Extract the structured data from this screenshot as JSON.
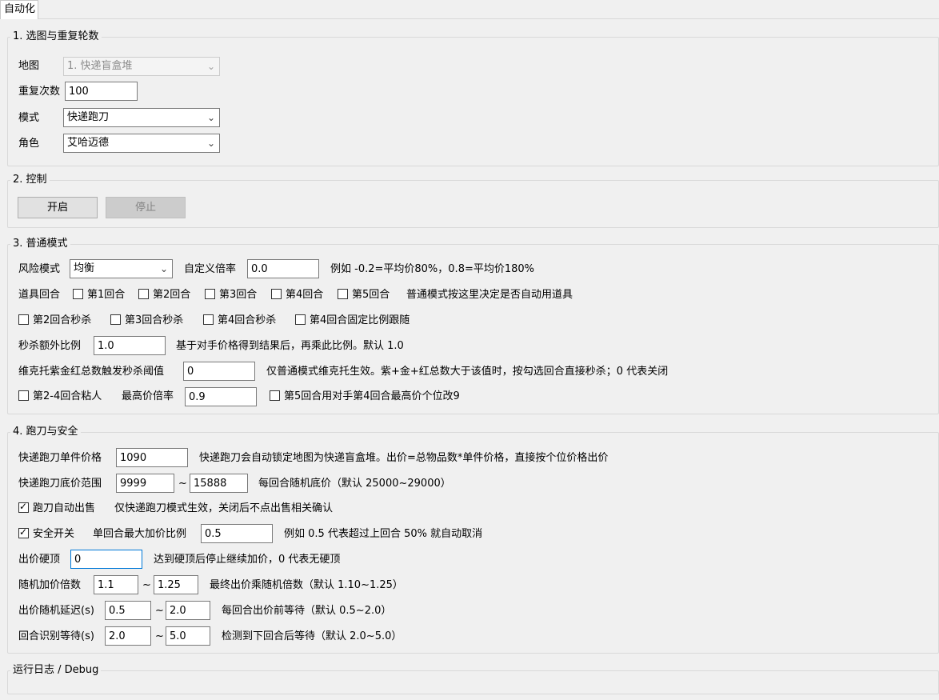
{
  "tab_label": "自动化",
  "sections": {
    "map_repeat": {
      "title": "1. 选图与重复轮数",
      "map_label": "地图",
      "map_value": "1. 快递盲盒堆",
      "repeat_label": "重复次数",
      "repeat_value": "100",
      "mode_label": "模式",
      "mode_value": "快递跑刀",
      "role_label": "角色",
      "role_value": "艾哈迈德"
    },
    "control": {
      "title": "2. 控制",
      "start_label": "开启",
      "stop_label": "停止"
    },
    "normal": {
      "title": "3. 普通模式",
      "risk_label": "风险模式",
      "risk_value": "均衡",
      "custom_rate_label": "自定义倍率",
      "custom_rate_value": "0.0",
      "custom_rate_hint": "例如 -0.2=平均价80%，0.8=平均价180%",
      "item_round_label": "道具回合",
      "rounds": [
        {
          "label": "第1回合",
          "checked": false
        },
        {
          "label": "第2回合",
          "checked": false
        },
        {
          "label": "第3回合",
          "checked": false
        },
        {
          "label": "第4回合",
          "checked": false
        },
        {
          "label": "第5回合",
          "checked": false
        }
      ],
      "item_round_hint": "普通模式按这里决定是否自动用道具",
      "kills": [
        {
          "label": "第2回合秒杀",
          "checked": false
        },
        {
          "label": "第3回合秒杀",
          "checked": false
        },
        {
          "label": "第4回合秒杀",
          "checked": false
        },
        {
          "label": "第4回合固定比例跟随",
          "checked": false
        }
      ],
      "kill_ratio_label": "秒杀额外比例",
      "kill_ratio_value": "1.0",
      "kill_ratio_hint": "基于对手价格得到结果后，再乘此比例。默认 1.0",
      "threshold_label": "维克托紫金红总数触发秒杀阈值",
      "threshold_value": "0",
      "threshold_hint": "仅普通模式维克托生效。紫+金+红总数大于该值时，按勾选回合直接秒杀；0 代表关闭",
      "sticky_label": "第2-4回合粘人",
      "sticky_checked": false,
      "max_rate_label": "最高价倍率",
      "max_rate_value": "0.9",
      "r5_label": "第5回合用对手第4回合最高价个位改9",
      "r5_checked": false
    },
    "run_safety": {
      "title": "4. 跑刀与安全",
      "unit_price_label": "快递跑刀单件价格",
      "unit_price_value": "1090",
      "unit_price_hint": "快递跑刀会自动锁定地图为快递盲盒堆。出价=总物品数*单件价格，直接按个位价格出价",
      "floor_label": "快递跑刀底价范围",
      "floor_min": "9999",
      "floor_sep": "~",
      "floor_max": "15888",
      "floor_hint": "每回合随机底价（默认 25000~29000）",
      "auto_sell_label": "跑刀自动出售",
      "auto_sell_checked": true,
      "auto_sell_hint": "仅快递跑刀模式生效，关闭后不点出售相关确认",
      "safety_label": "安全开关",
      "safety_checked": true,
      "max_raise_label": "单回合最大加价比例",
      "max_raise_value": "0.5",
      "max_raise_hint": "例如 0.5 代表超过上回合 50% 就自动取消",
      "cap_label": "出价硬顶",
      "cap_value": "0",
      "cap_hint": "达到硬顶后停止继续加价，0 代表无硬顶",
      "mult_label": "随机加价倍数",
      "mult_min": "1.1",
      "mult_sep": "~",
      "mult_max": "1.25",
      "mult_hint": "最终出价乘随机倍数（默认 1.10~1.25）",
      "delay_label": "出价随机延迟(s)",
      "delay_min": "0.5",
      "delay_sep": "~",
      "delay_max": "2.0",
      "delay_hint": "每回合出价前等待（默认 0.5~2.0）",
      "wait_label": "回合识别等待(s)",
      "wait_min": "2.0",
      "wait_sep": "~",
      "wait_max": "5.0",
      "wait_hint": "检测到下回合后等待（默认 2.0~5.0）"
    },
    "log": {
      "title": "运行日志 / Debug"
    }
  }
}
